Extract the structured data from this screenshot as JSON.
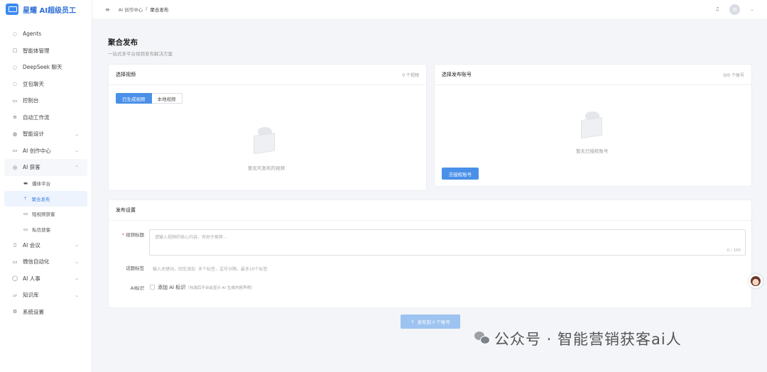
{
  "brand": {
    "name": "星耀 AI超级员工",
    "icon": "monitor-logo-icon"
  },
  "sidebar": {
    "items": [
      {
        "label": "Agents",
        "icon": "chat-icon"
      },
      {
        "label": "智能体管理",
        "icon": "robot-icon"
      },
      {
        "label": "DeepSeek 聊天",
        "icon": "chat-icon"
      },
      {
        "label": "豆包聊天",
        "icon": "chat-icon"
      },
      {
        "label": "控制台",
        "icon": "monitor-icon"
      },
      {
        "label": "自动工作流",
        "icon": "workflow-icon"
      },
      {
        "label": "智能设计",
        "icon": "palette-icon"
      },
      {
        "label": "AI 创作中心",
        "icon": "video-icon"
      },
      {
        "label": "AI 获客",
        "icon": "target-icon"
      }
    ],
    "sub_items": [
      {
        "label": "爆体平台",
        "icon": "monitor-icon"
      },
      {
        "label": "聚合发布",
        "icon": "upload-icon"
      },
      {
        "label": "短视频获客",
        "icon": "video-icon"
      },
      {
        "label": "私信获客",
        "icon": "message-icon"
      }
    ],
    "items_after": [
      {
        "label": "AI 会议",
        "icon": "mic-icon"
      },
      {
        "label": "微信自动化",
        "icon": "wechat-icon"
      },
      {
        "label": "AI 人事",
        "icon": "user-icon"
      },
      {
        "label": "知识库",
        "icon": "folder-icon"
      },
      {
        "label": "系统设置",
        "icon": "gear-icon"
      }
    ]
  },
  "header": {
    "breadcrumb_parent": "AI 创作中心",
    "breadcrumb_sep": "/",
    "breadcrumb_current": "聚合发布",
    "avatar_text": "用"
  },
  "page": {
    "title": "聚合发布",
    "subtitle": "一站式多平台视频发布解决方案"
  },
  "video_card": {
    "title": "选择视频",
    "count": "0 个视频",
    "tabs": [
      "已生成视频",
      "本地视频"
    ],
    "empty_text": "暂无可发布的视频"
  },
  "account_card": {
    "title": "选择发布账号",
    "count": "0/0 个账号",
    "empty_text": "暂无已授权账号",
    "button": "去授权账号"
  },
  "settings": {
    "title": "发布设置",
    "title_label": "视频标题",
    "title_placeholder": "请输入视频的核心内容，有助于推荐...",
    "title_count": "0 / 100",
    "tag_label": "话题标签",
    "tag_placeholder": "输入关键词，回车添加",
    "tag_hint": "多个标签，逗号分隔，最多10个标签",
    "ai_label": "AI标识",
    "ai_check_text": "添加 AI 标识",
    "ai_check_hint": "（勾选后平台会显示 AI 生成内容声明）"
  },
  "submit": {
    "label": "发布到 0 个账号"
  },
  "watermark": {
    "text": "公众号 · 智能营销获客ai人"
  }
}
